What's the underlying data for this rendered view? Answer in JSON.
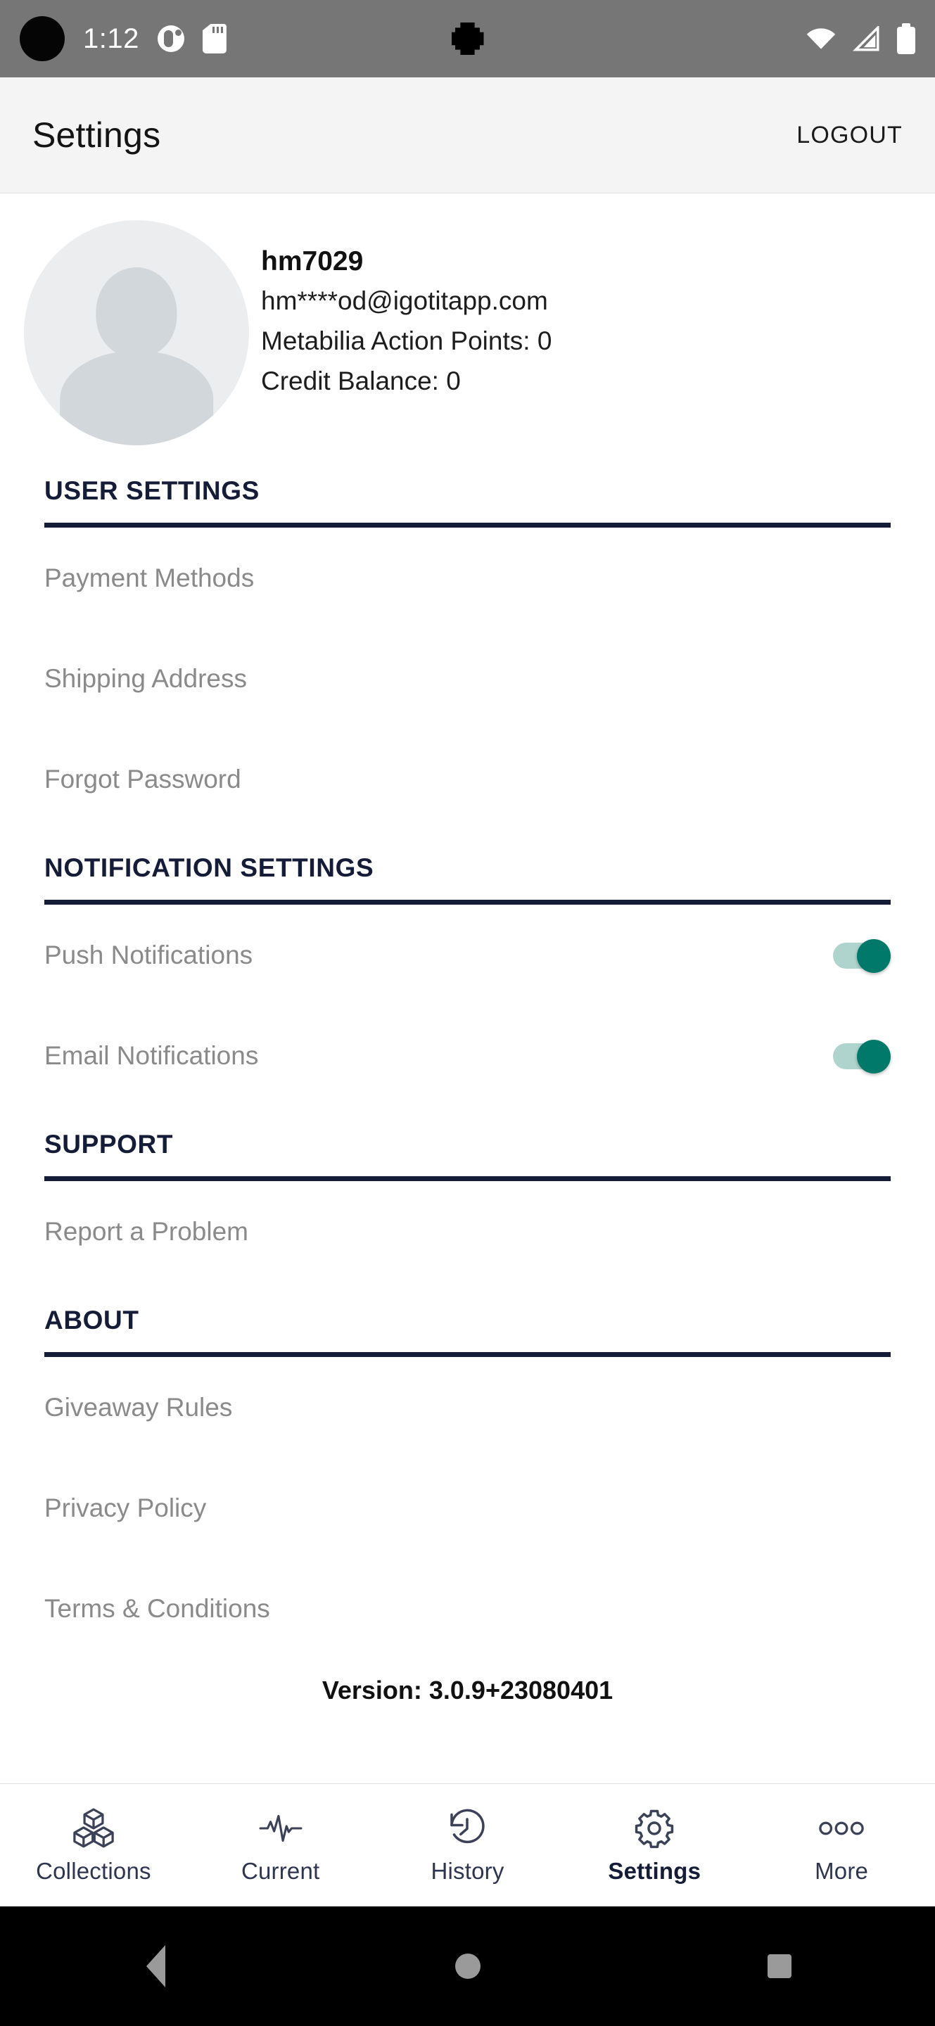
{
  "status_bar": {
    "time": "1:12",
    "icons": [
      "do-not-disturb-icon",
      "sdcard-icon",
      "wifi-icon",
      "cellular-signal-icon",
      "battery-icon"
    ]
  },
  "app_bar": {
    "title": "Settings",
    "logout_label": "LOGOUT"
  },
  "profile": {
    "username": "hm7029",
    "email": "hm****od@igotitapp.com",
    "action_points": "Metabilia Action Points: 0",
    "credit_balance": "Credit Balance: 0"
  },
  "sections": [
    {
      "heading": "USER SETTINGS",
      "items": [
        {
          "label": "Payment Methods",
          "type": "link"
        },
        {
          "label": "Shipping Address",
          "type": "link"
        },
        {
          "label": "Forgot Password",
          "type": "link"
        }
      ]
    },
    {
      "heading": "NOTIFICATION SETTINGS",
      "items": [
        {
          "label": "Push Notifications",
          "type": "toggle",
          "value": "on"
        },
        {
          "label": "Email Notifications",
          "type": "toggle",
          "value": "on"
        }
      ]
    },
    {
      "heading": "SUPPORT",
      "items": [
        {
          "label": "Report a Problem",
          "type": "link"
        }
      ]
    },
    {
      "heading": "ABOUT",
      "items": [
        {
          "label": "Giveaway Rules",
          "type": "link"
        },
        {
          "label": "Privacy Policy",
          "type": "link"
        },
        {
          "label": "Terms & Conditions",
          "type": "link"
        }
      ]
    }
  ],
  "version_text": "Version: 3.0.9+23080401",
  "bottom_nav": {
    "items": [
      {
        "label": "Collections",
        "icon": "cubes-icon",
        "active": false
      },
      {
        "label": "Current",
        "icon": "pulse-icon",
        "active": false
      },
      {
        "label": "History",
        "icon": "clock-rotate-icon",
        "active": false
      },
      {
        "label": "Settings",
        "icon": "gear-icon",
        "active": true
      },
      {
        "label": "More",
        "icon": "three-dots-icon",
        "active": false
      }
    ]
  },
  "android_nav": {
    "back": "back-button",
    "home": "home-button",
    "recents": "recent-apps-button"
  },
  "colors": {
    "accent_navy": "#141c38",
    "toggle_on_thumb": "#00796b",
    "toggle_on_track": "#aed4cd",
    "muted_text": "#8a8a8a",
    "status_bar_bg": "#767676",
    "app_bar_bg": "#f4f4f4"
  }
}
